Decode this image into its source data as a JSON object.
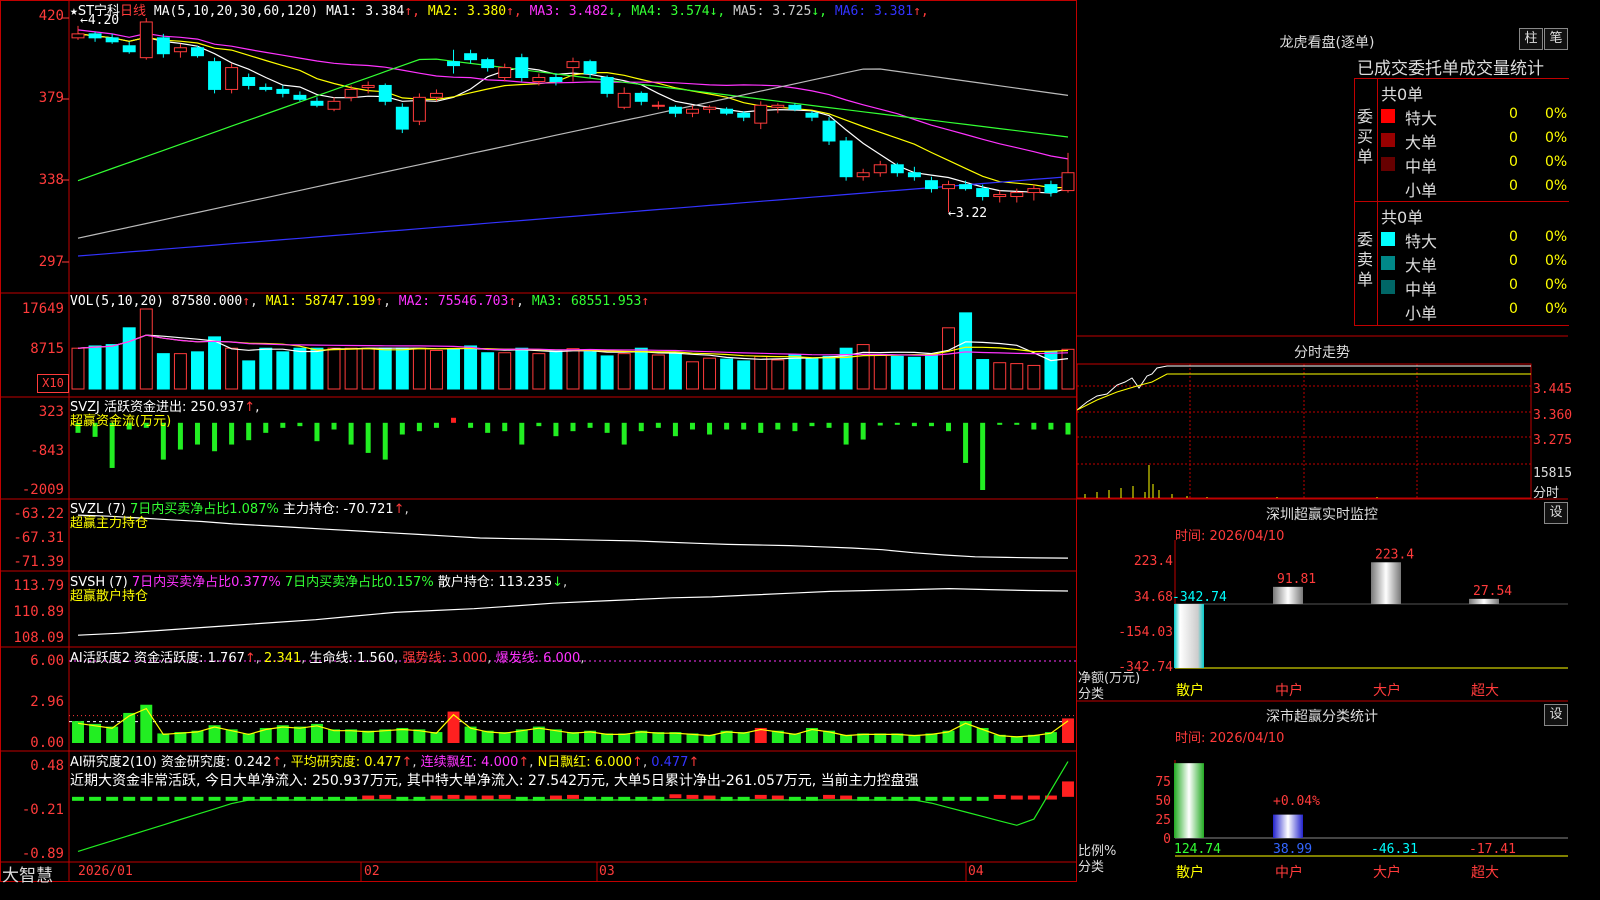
{
  "stock": {
    "star": "★",
    "name": "ST宁科",
    "period": "日线"
  },
  "price_header": {
    "label": "MA(5,10,20,30,60,120)",
    "items": [
      {
        "t": "MA1: 3.384",
        "arrow": "↑",
        "c": "#ffffff"
      },
      {
        "t": "MA2: 3.380",
        "arrow": "↑",
        "c": "#ffff00"
      },
      {
        "t": "MA3: 3.482",
        "arrow": "↓",
        "c": "#ff33ff"
      },
      {
        "t": "MA4: 3.574",
        "arrow": "↓",
        "c": "#33ff33"
      },
      {
        "t": "MA5: 3.725",
        "arrow": "↓",
        "c": "#cccccc"
      },
      {
        "t": "MA6: 3.381",
        "arrow": "↑",
        "c": "#3333ff"
      }
    ]
  },
  "price_axis": [
    "420",
    "379",
    "338",
    "297"
  ],
  "price_marks": {
    "high": "4.20",
    "low": "3.22"
  },
  "vol_header": {
    "label": "VOL(5,10,20)",
    "value": "87580.000",
    "ma1": "MA1: 58747.199",
    "ma2": "MA2: 75546.703",
    "ma3": "MA3: 68551.953"
  },
  "vol_axis": [
    "17649",
    "8715"
  ],
  "vol_unit": "X10",
  "svzj": {
    "l1": "SVZJ  活跃资金进出: 250.937",
    "l2": "超赢资金流(万元)",
    "axis": [
      "323",
      "-843",
      "-2009"
    ]
  },
  "svzl": {
    "l1a": "SVZL (7) ",
    "l1b": "7日内买卖净占比1.087%",
    "l1c": " 主力持仓: -70.721",
    "l2": "超赢主力持仓",
    "axis": [
      "-63.22",
      "-67.31",
      "-71.39"
    ]
  },
  "svsh": {
    "l1a": "SVSH (7) ",
    "l1b": "7日内买卖净占比0.377%",
    "l1c": " 7日内买卖净占比0.157%",
    "l1d": " 散户持仓: 113.235",
    "l2": "超赢散户持仓",
    "axis": [
      "113.79",
      "110.89",
      "108.09"
    ]
  },
  "ai1": {
    "l1a": "AI活跃度2 资金活跃度: 1.767",
    "l1b": " 2.341",
    "l1c": " 生命线: 1.560",
    "l1d": " 强势线: 3.000",
    "l1e": " 爆发线: 6.000",
    "axis": [
      "6.00",
      "2.96",
      "0.00"
    ]
  },
  "ai2": {
    "l1a": "AI研究度2(10) 资金研究度: 0.242",
    "l1b": " 平均研究度: 0.477",
    "l1c": " 连续飘红: 4.000",
    "l1d": " N日飘红: 6.000",
    "l1e": " 0.477",
    "l2": "近期大资金非常活跃, 今日大单净流入: 250.937万元, 其中特大单净流入: 27.542万元, 大单5日累计净出-261.057万元, 当前主力控盘强",
    "axis": [
      "0.48",
      "-0.21",
      "-0.89"
    ]
  },
  "date_axis": [
    "2026/01",
    "02",
    "03",
    "04"
  ],
  "brand": "大智慧",
  "dragon": {
    "title": "龙虎看盘(逐单)",
    "btn1": "柱",
    "btn2": "笔",
    "sub": "已成交委托单成交量统计",
    "buy_side": "委买单",
    "sell_side": "委卖单",
    "count": "共0单",
    "rows": [
      {
        "label": "特大",
        "v": "0",
        "p": "0%",
        "c": "#ff0000"
      },
      {
        "label": "大单",
        "v": "0",
        "p": "0%",
        "c": "#990000"
      },
      {
        "label": "中单",
        "v": "0",
        "p": "0%",
        "c": "#660000"
      },
      {
        "label": "小单",
        "v": "0",
        "p": "0%",
        "c": "#000000"
      }
    ],
    "rows_sell": [
      {
        "label": "特大",
        "v": "0",
        "p": "0%",
        "c": "#00ffff"
      },
      {
        "label": "大单",
        "v": "0",
        "p": "0%",
        "c": "#008888"
      },
      {
        "label": "中单",
        "v": "0",
        "p": "0%",
        "c": "#006666"
      },
      {
        "label": "小单",
        "v": "0",
        "p": "0%",
        "c": "#000000"
      }
    ]
  },
  "intraday": {
    "title": "分时走势",
    "axis": [
      "3.445",
      "3.360",
      "3.275"
    ],
    "vol": "15815",
    "unit": "分时"
  },
  "monitor": {
    "title": "深圳超赢实时监控",
    "set": "设",
    "time": "时间: 2026/04/10",
    "axis": [
      "223.4",
      "34.68",
      "-154.03",
      "-342.74"
    ],
    "ylab": "净额(万元)",
    "xlab": "分类",
    "cats": [
      "散户",
      "中户",
      "大户",
      "超大"
    ],
    "vals": [
      "-342.74",
      "91.81",
      "223.4",
      "27.54"
    ]
  },
  "classify": {
    "title": "深市超赢分类统计",
    "set": "设",
    "time": "时间: 2026/04/10",
    "axis": [
      "75",
      "50",
      "25",
      "0"
    ],
    "ylab": "比例%",
    "xlab": "分类",
    "cats": [
      "散户",
      "中户",
      "大户",
      "超大"
    ],
    "vals": [
      "124.74",
      "38.99",
      "-46.31",
      "-17.41"
    ],
    "mid": "+0.04%"
  },
  "chart_data": [
    {
      "type": "candlestick",
      "title": "ST宁科 日线",
      "ylim": [
        2.97,
        4.2
      ],
      "ohlc": [
        [
          4.1,
          4.16,
          4.09,
          4.12
        ],
        [
          4.12,
          4.13,
          4.08,
          4.1
        ],
        [
          4.1,
          4.12,
          4.07,
          4.08
        ],
        [
          4.06,
          4.08,
          4.02,
          4.03
        ],
        [
          4.0,
          4.2,
          3.99,
          4.18
        ],
        [
          4.1,
          4.12,
          4.0,
          4.02
        ],
        [
          4.03,
          4.07,
          4.0,
          4.05
        ],
        [
          4.05,
          4.06,
          4.0,
          4.01
        ],
        [
          3.98,
          4.0,
          3.82,
          3.84
        ],
        [
          3.84,
          3.97,
          3.82,
          3.95
        ],
        [
          3.9,
          3.92,
          3.84,
          3.86
        ],
        [
          3.85,
          3.87,
          3.83,
          3.84
        ],
        [
          3.84,
          3.86,
          3.8,
          3.82
        ],
        [
          3.81,
          3.83,
          3.78,
          3.79
        ],
        [
          3.78,
          3.8,
          3.75,
          3.76
        ],
        [
          3.74,
          3.8,
          3.73,
          3.78
        ],
        [
          3.8,
          3.86,
          3.78,
          3.84
        ],
        [
          3.85,
          3.88,
          3.82,
          3.86
        ],
        [
          3.86,
          3.87,
          3.76,
          3.78
        ],
        [
          3.75,
          3.77,
          3.62,
          3.64
        ],
        [
          3.68,
          3.82,
          3.66,
          3.8
        ],
        [
          3.8,
          3.84,
          3.78,
          3.82
        ],
        [
          3.98,
          4.04,
          3.92,
          3.96
        ],
        [
          4.02,
          4.04,
          3.97,
          3.99
        ],
        [
          3.99,
          4.0,
          3.93,
          3.95
        ],
        [
          3.9,
          3.97,
          3.88,
          3.95
        ],
        [
          4.0,
          4.02,
          3.88,
          3.9
        ],
        [
          3.88,
          3.92,
          3.86,
          3.9
        ],
        [
          3.9,
          3.92,
          3.86,
          3.88
        ],
        [
          3.95,
          4.0,
          3.88,
          3.98
        ],
        [
          3.98,
          3.99,
          3.9,
          3.92
        ],
        [
          3.9,
          3.91,
          3.8,
          3.82
        ],
        [
          3.75,
          3.85,
          3.74,
          3.82
        ],
        [
          3.82,
          3.83,
          3.76,
          3.78
        ],
        [
          3.76,
          3.78,
          3.74,
          3.76
        ],
        [
          3.75,
          3.76,
          3.7,
          3.72
        ],
        [
          3.72,
          3.76,
          3.7,
          3.74
        ],
        [
          3.74,
          3.76,
          3.72,
          3.75
        ],
        [
          3.74,
          3.75,
          3.71,
          3.72
        ],
        [
          3.72,
          3.73,
          3.68,
          3.7
        ],
        [
          3.67,
          3.78,
          3.64,
          3.76
        ],
        [
          3.75,
          3.77,
          3.72,
          3.76
        ],
        [
          3.76,
          3.77,
          3.73,
          3.74
        ],
        [
          3.72,
          3.73,
          3.68,
          3.7
        ],
        [
          3.68,
          3.7,
          3.56,
          3.58
        ],
        [
          3.58,
          3.6,
          3.38,
          3.4
        ],
        [
          3.4,
          3.44,
          3.38,
          3.42
        ],
        [
          3.42,
          3.48,
          3.4,
          3.46
        ],
        [
          3.46,
          3.47,
          3.4,
          3.42
        ],
        [
          3.42,
          3.45,
          3.38,
          3.4
        ],
        [
          3.38,
          3.4,
          3.32,
          3.34
        ],
        [
          3.34,
          3.38,
          3.22,
          3.36
        ],
        [
          3.36,
          3.38,
          3.33,
          3.34
        ],
        [
          3.34,
          3.36,
          3.28,
          3.3
        ],
        [
          3.3,
          3.33,
          3.27,
          3.31
        ],
        [
          3.3,
          3.34,
          3.27,
          3.32
        ],
        [
          3.32,
          3.36,
          3.28,
          3.34
        ],
        [
          3.36,
          3.38,
          3.3,
          3.32
        ],
        [
          3.33,
          3.52,
          3.32,
          3.42
        ]
      ]
    },
    {
      "type": "bar",
      "title": "VOL(5,10,20)",
      "ylim": [
        0,
        17649
      ],
      "values": [
        9000,
        9500,
        9800,
        13500,
        17649,
        7800,
        7800,
        8200,
        11500,
        9000,
        6200,
        9000,
        8200,
        9000,
        9000,
        9000,
        9000,
        9000,
        9000,
        9000,
        9000,
        8500,
        8800,
        9500,
        8000,
        8000,
        9000,
        7800,
        8400,
        8900,
        8200,
        7300,
        7800,
        9000,
        7500,
        8000,
        6000,
        6800,
        6600,
        6200,
        7200,
        6400,
        7600,
        6800,
        7200,
        9000,
        9800,
        7400,
        7200,
        7000,
        7600,
        13500,
        16800,
        6500,
        5800,
        5600,
        5200,
        8200,
        8758
      ]
    },
    {
      "type": "bar",
      "title": "SVZJ 超赢资金流(万元)",
      "ylim": [
        -2009,
        323
      ],
      "values": [
        -300,
        -420,
        -1350,
        -200,
        -150,
        -1100,
        -800,
        -650,
        -850,
        -650,
        -520,
        -300,
        -150,
        -100,
        -550,
        -200,
        -650,
        -900,
        -1100,
        -350,
        -250,
        -150,
        150,
        -150,
        -300,
        -250,
        -650,
        -100,
        -400,
        -250,
        -150,
        -300,
        -650,
        -250,
        -150,
        -400,
        -200,
        -350,
        -200,
        -200,
        -300,
        -200,
        -250,
        -100,
        -150,
        -650,
        -500,
        -80,
        -50,
        -100,
        -100,
        -250,
        -1200,
        -2009,
        -60,
        -40,
        -200,
        -200,
        -350,
        251
      ]
    },
    {
      "type": "line",
      "title": "SVZL 主力持仓",
      "ylim": [
        -71.39,
        -63.22
      ],
      "values": [
        -63.4,
        -63.6,
        -63.9,
        -64.2,
        -64.5,
        -64.9,
        -65.2,
        -65.5,
        -65.8,
        -66.1,
        -66.4,
        -66.7,
        -67.0,
        -67.3,
        -67.4,
        -67.5,
        -67.6,
        -67.7,
        -67.8,
        -68.0,
        -68.2,
        -68.4,
        -68.5,
        -68.6,
        -68.8,
        -69.0,
        -69.3,
        -69.8,
        -70.2,
        -70.5,
        -70.6,
        -70.7,
        -70.72
      ]
    },
    {
      "type": "line",
      "title": "SVSH 散户持仓",
      "ylim": [
        108.09,
        113.79
      ],
      "values": [
        108.4,
        108.6,
        108.9,
        109.2,
        109.5,
        109.8,
        110.1,
        110.5,
        110.9,
        111.1,
        111.3,
        111.6,
        111.9,
        112.1,
        112.3,
        112.5,
        112.6,
        112.8,
        113.0,
        113.2,
        113.3,
        113.4,
        113.5,
        113.4,
        113.3,
        113.24
      ]
    },
    {
      "type": "bar",
      "title": "AI活跃度2",
      "ylim": [
        0,
        6
      ],
      "values": [
        1.6,
        1.4,
        1.2,
        2.2,
        2.8,
        0.7,
        0.8,
        0.9,
        1.3,
        1.0,
        0.7,
        1.1,
        1.3,
        1.2,
        1.4,
        1.0,
        1.0,
        0.9,
        1.0,
        1.1,
        1.0,
        0.8,
        2.3,
        1.2,
        0.9,
        0.8,
        1.0,
        1.2,
        1.0,
        0.8,
        0.9,
        0.7,
        0.7,
        0.9,
        0.8,
        0.8,
        0.7,
        0.6,
        0.9,
        0.8,
        1.1,
        0.9,
        0.7,
        1.1,
        0.9,
        0.6,
        0.7,
        0.7,
        0.7,
        0.6,
        0.7,
        0.9,
        1.6,
        1.1,
        0.6,
        0.5,
        0.6,
        0.8,
        1.8
      ]
    },
    {
      "type": "bar",
      "title": "AI研究度2(10)",
      "ylim": [
        -0.89,
        0.48
      ],
      "values": [
        -0.02,
        -0.02,
        -0.02,
        -0.03,
        -0.04,
        -0.05,
        -0.05,
        -0.04,
        -0.03,
        -0.04,
        -0.05,
        -0.04,
        -0.02,
        -0.02,
        -0.04,
        -0.03,
        -0.02,
        0.02,
        0.03,
        -0.02,
        -0.02,
        0.02,
        0.03,
        0.02,
        0.02,
        0.03,
        -0.02,
        -0.02,
        0.02,
        0.03,
        -0.02,
        -0.02,
        -0.04,
        -0.04,
        -0.03,
        0.04,
        0.03,
        0.02,
        -0.03,
        -0.02,
        0.03,
        0.02,
        -0.02,
        -0.02,
        0.03,
        0.02,
        -0.02,
        -0.02,
        -0.02,
        -0.02,
        -0.02,
        -0.04,
        -0.04,
        -0.06,
        0.03,
        0.02,
        0.02,
        0.02,
        0.24
      ]
    }
  ]
}
